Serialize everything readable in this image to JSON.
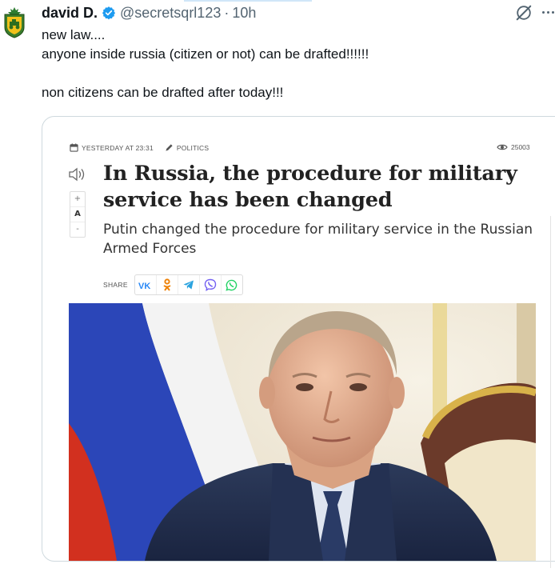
{
  "tweet": {
    "author_name": "david D.",
    "handle": "@secretsqrl123",
    "separator": "·",
    "time": "10h",
    "verified": true,
    "icons": {
      "avatar": "avatar-emblem-icon",
      "verified": "verified-badge-icon",
      "grok": "grok-icon",
      "more": "more-options-icon"
    },
    "text_lines": [
      "new law....",
      "anyone inside russia (citizen or not) can be drafted!!!!!!",
      "non citizens can be drafted after today!!!"
    ]
  },
  "article": {
    "date": "YESTERDAY AT 23:31",
    "category": "POLITICS",
    "views": "25003",
    "headline": "In Russia, the procedure for military service has been changed",
    "subheadline": "Putin changed the procedure for military service in the Russian Armed Forces",
    "font_controls": {
      "increase": "+",
      "normal": "A",
      "decrease": "-"
    },
    "share_label": "SHARE",
    "share_buttons": [
      "vk",
      "odnoklassniki",
      "telegram",
      "viber",
      "whatsapp"
    ],
    "icons": {
      "calendar": "calendar-icon",
      "pencil": "pencil-icon",
      "eye": "eye-icon",
      "speaker": "speaker-icon"
    },
    "image": "photo of a man in a suit in front of a flag"
  },
  "colors": {
    "verified": "#1d9bf0",
    "text": "#0f1419",
    "muted": "#536471",
    "card_border": "#cfd9de",
    "vk": "#2787f5",
    "ok": "#ee8208",
    "telegram": "#2aa3df",
    "viber": "#7360f2",
    "whatsapp": "#25d366"
  }
}
